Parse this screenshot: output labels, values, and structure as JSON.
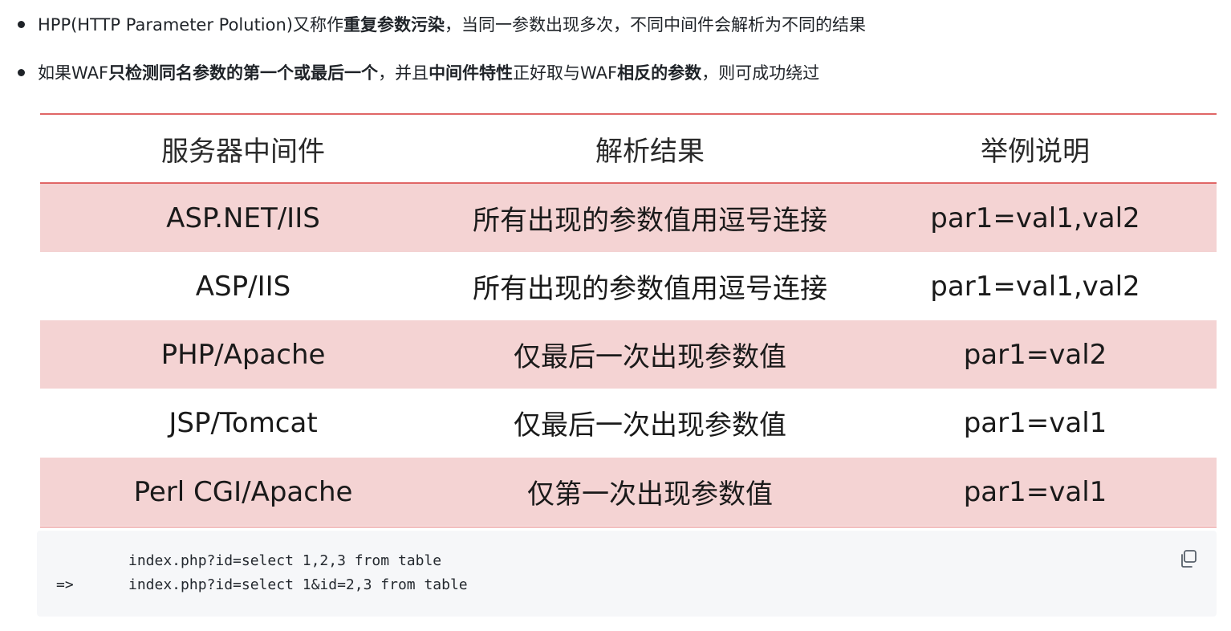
{
  "bullets": [
    {
      "segments": [
        {
          "text": "HPP(HTTP Parameter Polution)又称作",
          "bold": false
        },
        {
          "text": "重复参数污染",
          "bold": true
        },
        {
          "text": "，当同一参数出现多次，不同中间件会解析为不同的结果",
          "bold": false
        }
      ]
    },
    {
      "segments": [
        {
          "text": "如果WAF",
          "bold": false
        },
        {
          "text": "只检测同名参数的第一个或最后一个",
          "bold": true
        },
        {
          "text": "，并且",
          "bold": false
        },
        {
          "text": "中间件特性",
          "bold": true
        },
        {
          "text": "正好取与WAF",
          "bold": false
        },
        {
          "text": "相反的参数",
          "bold": true
        },
        {
          "text": "，则可成功绕过",
          "bold": false
        }
      ]
    }
  ],
  "table": {
    "headers": [
      "服务器中间件",
      "解析结果",
      "举例说明"
    ],
    "rows": [
      [
        "ASP.NET/IIS",
        "所有出现的参数值用逗号连接",
        "par1=val1,val2"
      ],
      [
        "ASP/IIS",
        "所有出现的参数值用逗号连接",
        "par1=val1,val2"
      ],
      [
        "PHP/Apache",
        "仅最后一次出现参数值",
        "par1=val2"
      ],
      [
        "JSP/Tomcat",
        "仅最后一次出现参数值",
        "par1=val1"
      ],
      [
        "Perl CGI/Apache",
        "仅第一次出现参数值",
        "par1=val1"
      ]
    ]
  },
  "code": {
    "lines": [
      {
        "prefix": "",
        "text": "index.php?id=select 1,2,3 from table"
      },
      {
        "prefix": "=>",
        "text": "index.php?id=select 1&id=2,3 from table"
      }
    ],
    "copy_icon": "copy-icon"
  },
  "colors": {
    "row_shade": "#f4d3d3",
    "table_rule": "#e06666",
    "code_bg": "#f6f7f9"
  }
}
